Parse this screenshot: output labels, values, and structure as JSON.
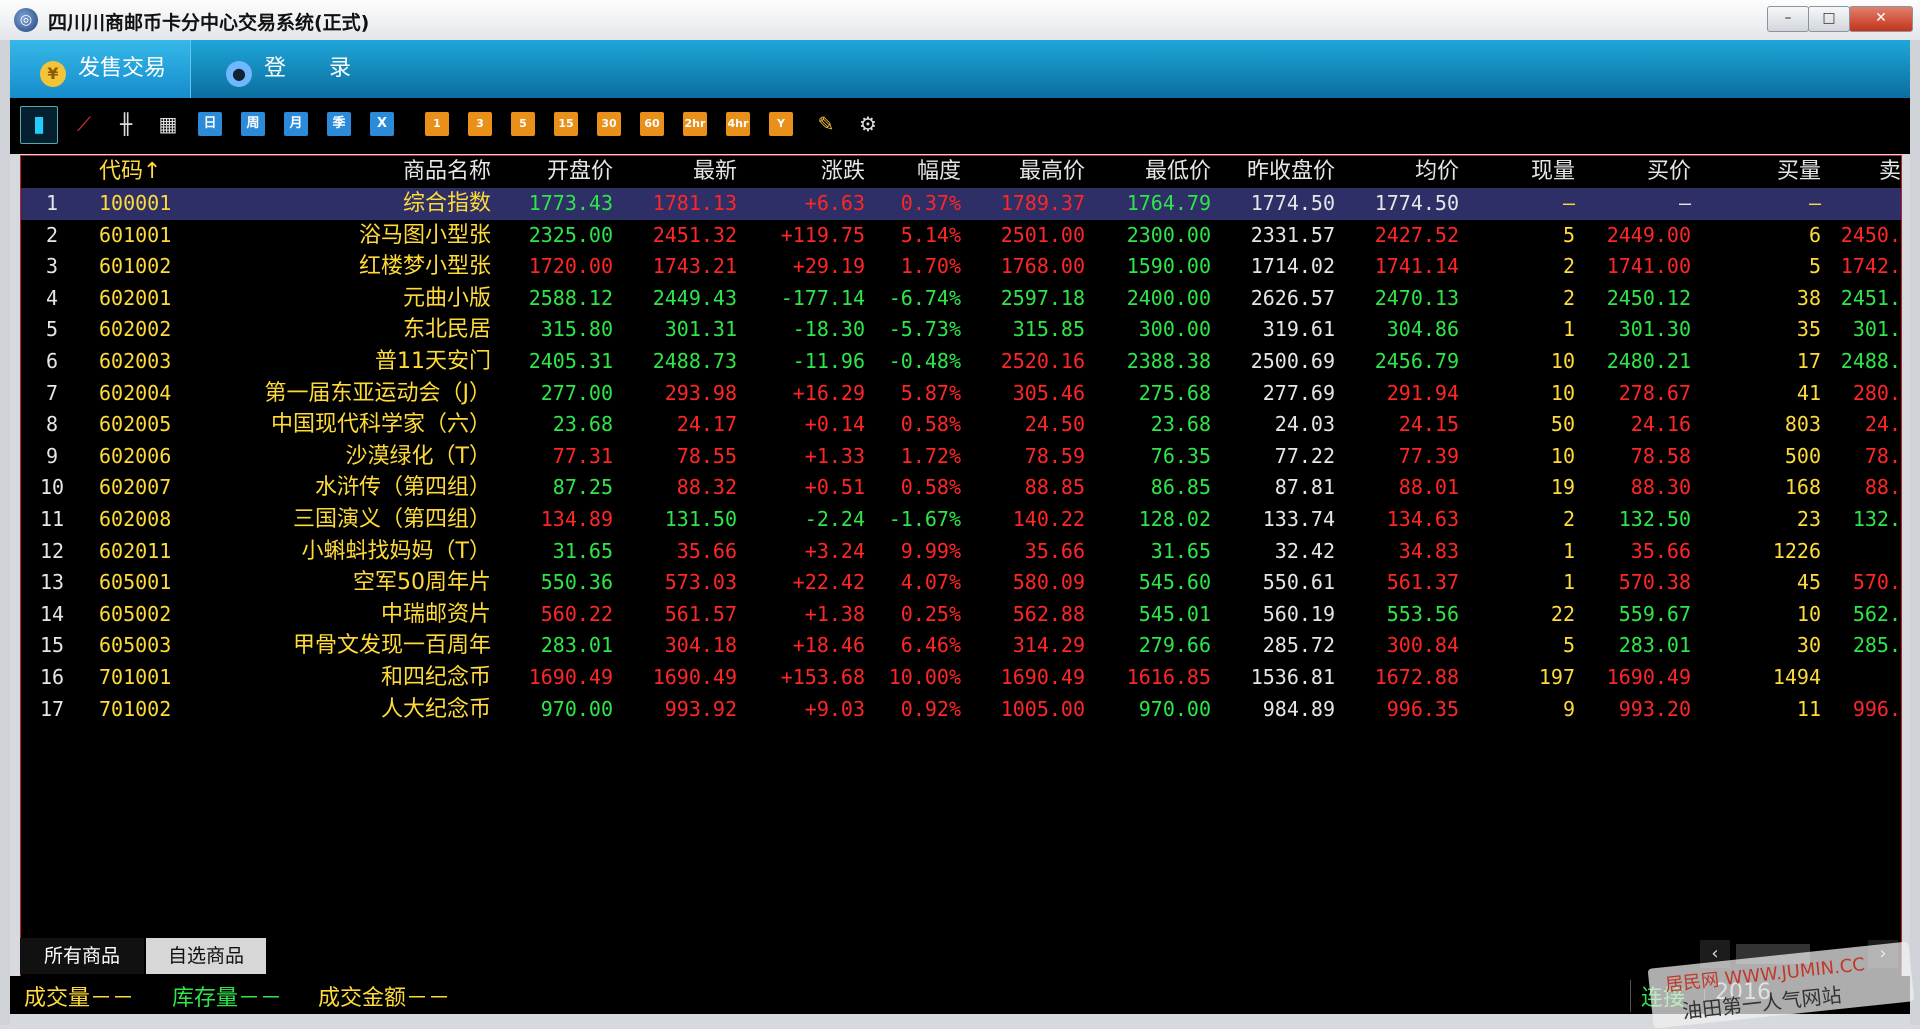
{
  "window": {
    "title": "四川川商邮币卡分中心交易系统(正式)",
    "min": "–",
    "max": "□",
    "close": "✕"
  },
  "nav": {
    "tab_sell": "发售交易",
    "tab_login": "登 录"
  },
  "toolbar": {
    "periods": [
      "日",
      "周",
      "月",
      "季",
      "X"
    ],
    "minutes": [
      "1",
      "3",
      "5",
      "15",
      "30",
      "60",
      "2hr",
      "4hr",
      "Y"
    ]
  },
  "table": {
    "headers": [
      "",
      "代码↑",
      "商品名称",
      "开盘价",
      "最新",
      "涨跌",
      "幅度",
      "最高价",
      "最低价",
      "昨收盘价",
      "均价",
      "现量",
      "买价",
      "买量",
      "卖"
    ],
    "rows": [
      {
        "idx": "1",
        "code": "100001",
        "name": "综合指数",
        "open": "1773.43",
        "last": "1781.13",
        "chg": "+6.63",
        "pct": "0.37%",
        "high": "1789.37",
        "low": "1764.79",
        "prev": "1774.50",
        "avg": "1774.50",
        "vol": "—",
        "bid": "—",
        "bidq": "—",
        "ask": "",
        "c": [
          "dn",
          "up",
          "up",
          "up",
          "up",
          "dn",
          "eq",
          "eq"
        ]
      },
      {
        "idx": "2",
        "code": "601001",
        "name": "浴马图小型张",
        "open": "2325.00",
        "last": "2451.32",
        "chg": "+119.75",
        "pct": "5.14%",
        "high": "2501.00",
        "low": "2300.00",
        "prev": "2331.57",
        "avg": "2427.52",
        "vol": "5",
        "bid": "2449.00",
        "bidq": "6",
        "ask": "2450.",
        "c": [
          "dn",
          "up",
          "up",
          "up",
          "up",
          "dn",
          "up",
          "up"
        ]
      },
      {
        "idx": "3",
        "code": "601002",
        "name": "红楼梦小型张",
        "open": "1720.00",
        "last": "1743.21",
        "chg": "+29.19",
        "pct": "1.70%",
        "high": "1768.00",
        "low": "1590.00",
        "prev": "1714.02",
        "avg": "1741.14",
        "vol": "2",
        "bid": "1741.00",
        "bidq": "5",
        "ask": "1742.",
        "c": [
          "up",
          "up",
          "up",
          "up",
          "up",
          "dn",
          "up",
          "up"
        ]
      },
      {
        "idx": "4",
        "code": "602001",
        "name": "元曲小版",
        "open": "2588.12",
        "last": "2449.43",
        "chg": "-177.14",
        "pct": "-6.74%",
        "high": "2597.18",
        "low": "2400.00",
        "prev": "2626.57",
        "avg": "2470.13",
        "vol": "2",
        "bid": "2450.12",
        "bidq": "38",
        "ask": "2451.",
        "c": [
          "dn",
          "dn",
          "dn",
          "dn",
          "dn",
          "dn",
          "dn",
          "dn"
        ]
      },
      {
        "idx": "5",
        "code": "602002",
        "name": "东北民居",
        "open": "315.80",
        "last": "301.31",
        "chg": "-18.30",
        "pct": "-5.73%",
        "high": "315.85",
        "low": "300.00",
        "prev": "319.61",
        "avg": "304.86",
        "vol": "1",
        "bid": "301.30",
        "bidq": "35",
        "ask": "301.",
        "c": [
          "dn",
          "dn",
          "dn",
          "dn",
          "dn",
          "dn",
          "dn",
          "dn"
        ]
      },
      {
        "idx": "6",
        "code": "602003",
        "name": "普11天安门",
        "open": "2405.31",
        "last": "2488.73",
        "chg": "-11.96",
        "pct": "-0.48%",
        "high": "2520.16",
        "low": "2388.38",
        "prev": "2500.69",
        "avg": "2456.79",
        "vol": "10",
        "bid": "2480.21",
        "bidq": "17",
        "ask": "2488.",
        "c": [
          "dn",
          "dn",
          "dn",
          "dn",
          "up",
          "dn",
          "dn",
          "dn"
        ]
      },
      {
        "idx": "7",
        "code": "602004",
        "name": "第一届东亚运动会（J）",
        "open": "277.00",
        "last": "293.98",
        "chg": "+16.29",
        "pct": "5.87%",
        "high": "305.46",
        "low": "275.68",
        "prev": "277.69",
        "avg": "291.94",
        "vol": "10",
        "bid": "278.67",
        "bidq": "41",
        "ask": "280.",
        "c": [
          "dn",
          "up",
          "up",
          "up",
          "up",
          "dn",
          "up",
          "up"
        ]
      },
      {
        "idx": "8",
        "code": "602005",
        "name": "中国现代科学家（六）",
        "open": "23.68",
        "last": "24.17",
        "chg": "+0.14",
        "pct": "0.58%",
        "high": "24.50",
        "low": "23.68",
        "prev": "24.03",
        "avg": "24.15",
        "vol": "50",
        "bid": "24.16",
        "bidq": "803",
        "ask": "24.",
        "c": [
          "dn",
          "up",
          "up",
          "up",
          "up",
          "dn",
          "up",
          "up"
        ]
      },
      {
        "idx": "9",
        "code": "602006",
        "name": "沙漠绿化（T）",
        "open": "77.31",
        "last": "78.55",
        "chg": "+1.33",
        "pct": "1.72%",
        "high": "78.59",
        "low": "76.35",
        "prev": "77.22",
        "avg": "77.39",
        "vol": "10",
        "bid": "78.58",
        "bidq": "500",
        "ask": "78.",
        "c": [
          "up",
          "up",
          "up",
          "up",
          "up",
          "dn",
          "up",
          "up"
        ]
      },
      {
        "idx": "10",
        "code": "602007",
        "name": "水浒传（第四组）",
        "open": "87.25",
        "last": "88.32",
        "chg": "+0.51",
        "pct": "0.58%",
        "high": "88.85",
        "low": "86.85",
        "prev": "87.81",
        "avg": "88.01",
        "vol": "19",
        "bid": "88.30",
        "bidq": "168",
        "ask": "88.",
        "c": [
          "dn",
          "up",
          "up",
          "up",
          "up",
          "dn",
          "up",
          "up"
        ]
      },
      {
        "idx": "11",
        "code": "602008",
        "name": "三国演义（第四组）",
        "open": "134.89",
        "last": "131.50",
        "chg": "-2.24",
        "pct": "-1.67%",
        "high": "140.22",
        "low": "128.02",
        "prev": "133.74",
        "avg": "134.63",
        "vol": "2",
        "bid": "132.50",
        "bidq": "23",
        "ask": "132.",
        "c": [
          "up",
          "dn",
          "dn",
          "dn",
          "up",
          "dn",
          "up",
          "dn"
        ]
      },
      {
        "idx": "12",
        "code": "602011",
        "name": "小蝌蚪找妈妈（T）",
        "open": "31.65",
        "last": "35.66",
        "chg": "+3.24",
        "pct": "9.99%",
        "high": "35.66",
        "low": "31.65",
        "prev": "32.42",
        "avg": "34.83",
        "vol": "1",
        "bid": "35.66",
        "bidq": "1226",
        "ask": "",
        "c": [
          "dn",
          "up",
          "up",
          "up",
          "up",
          "dn",
          "up",
          "up"
        ]
      },
      {
        "idx": "13",
        "code": "605001",
        "name": "空军50周年片",
        "open": "550.36",
        "last": "573.03",
        "chg": "+22.42",
        "pct": "4.07%",
        "high": "580.09",
        "low": "545.60",
        "prev": "550.61",
        "avg": "561.37",
        "vol": "1",
        "bid": "570.38",
        "bidq": "45",
        "ask": "570.",
        "c": [
          "dn",
          "up",
          "up",
          "up",
          "up",
          "dn",
          "up",
          "up"
        ]
      },
      {
        "idx": "14",
        "code": "605002",
        "name": "中瑞邮资片",
        "open": "560.22",
        "last": "561.57",
        "chg": "+1.38",
        "pct": "0.25%",
        "high": "562.88",
        "low": "545.01",
        "prev": "560.19",
        "avg": "553.56",
        "vol": "22",
        "bid": "559.67",
        "bidq": "10",
        "ask": "562.",
        "c": [
          "up",
          "up",
          "up",
          "up",
          "up",
          "dn",
          "dn",
          "dn"
        ]
      },
      {
        "idx": "15",
        "code": "605003",
        "name": "甲骨文发现一百周年",
        "open": "283.01",
        "last": "304.18",
        "chg": "+18.46",
        "pct": "6.46%",
        "high": "314.29",
        "low": "279.66",
        "prev": "285.72",
        "avg": "300.84",
        "vol": "5",
        "bid": "283.01",
        "bidq": "30",
        "ask": "285.",
        "c": [
          "dn",
          "up",
          "up",
          "up",
          "up",
          "dn",
          "up",
          "dn"
        ]
      },
      {
        "idx": "16",
        "code": "701001",
        "name": "和四纪念币",
        "open": "1690.49",
        "last": "1690.49",
        "chg": "+153.68",
        "pct": "10.00%",
        "high": "1690.49",
        "low": "1616.85",
        "prev": "1536.81",
        "avg": "1672.88",
        "vol": "197",
        "bid": "1690.49",
        "bidq": "1494",
        "ask": "",
        "c": [
          "up",
          "up",
          "up",
          "up",
          "up",
          "up",
          "up",
          "up"
        ]
      },
      {
        "idx": "17",
        "code": "701002",
        "name": "人大纪念币",
        "open": "970.00",
        "last": "993.92",
        "chg": "+9.03",
        "pct": "0.92%",
        "high": "1005.00",
        "low": "970.00",
        "prev": "984.89",
        "avg": "996.35",
        "vol": "9",
        "bid": "993.20",
        "bidq": "11",
        "ask": "996.",
        "c": [
          "dn",
          "up",
          "up",
          "up",
          "up",
          "dn",
          "up",
          "up"
        ]
      }
    ]
  },
  "bottom_tabs": {
    "all": "所有商品",
    "fav": "自选商品"
  },
  "status": {
    "volume": "成交量－－",
    "stock": "库存量－－",
    "amount": "成交金额－－",
    "conn": "连接",
    "date": "2016"
  },
  "watermark": {
    "line1": "居民网 WWW.JUMIN.CC",
    "line2": "油田第一人气网站"
  }
}
